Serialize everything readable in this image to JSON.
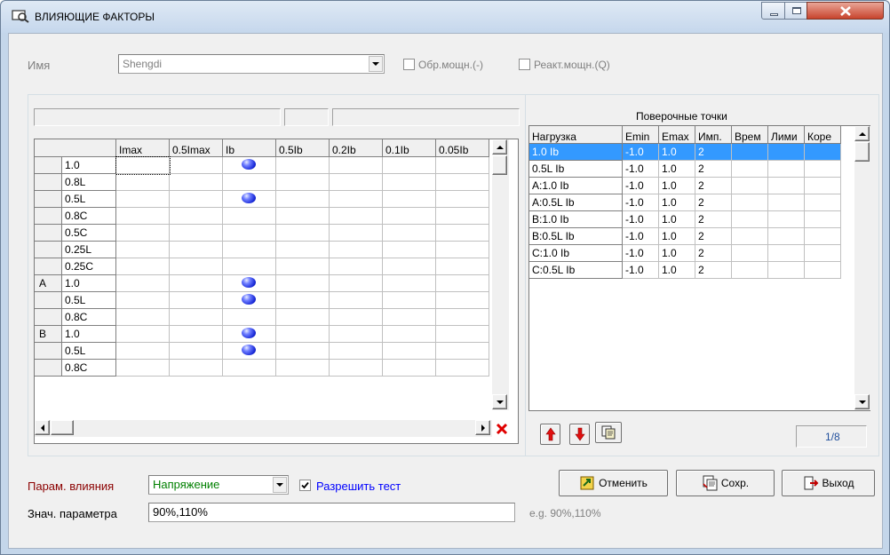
{
  "window": {
    "title": "ВЛИЯЮЩИЕ ФАКТОРЫ"
  },
  "top": {
    "name_label": "Имя",
    "name_value": "Shengdi",
    "check_active_power": "Обр.мощн.(-)",
    "check_reactive_power": "Реакт.мощн.(Q)"
  },
  "matrix": {
    "columns": [
      "Imax",
      "0.5Imax",
      "Ib",
      "0.5Ib",
      "0.2Ib",
      "0.1Ib",
      "0.05Ib"
    ],
    "rows": [
      {
        "group": "",
        "pf": "1.0",
        "marks": [
          false,
          false,
          true,
          false,
          false,
          false,
          false
        ]
      },
      {
        "group": "",
        "pf": "0.8L",
        "marks": [
          false,
          false,
          false,
          false,
          false,
          false,
          false
        ]
      },
      {
        "group": "",
        "pf": "0.5L",
        "marks": [
          false,
          false,
          true,
          false,
          false,
          false,
          false
        ]
      },
      {
        "group": "",
        "pf": "0.8C",
        "marks": [
          false,
          false,
          false,
          false,
          false,
          false,
          false
        ]
      },
      {
        "group": "",
        "pf": "0.5C",
        "marks": [
          false,
          false,
          false,
          false,
          false,
          false,
          false
        ]
      },
      {
        "group": "",
        "pf": "0.25L",
        "marks": [
          false,
          false,
          false,
          false,
          false,
          false,
          false
        ]
      },
      {
        "group": "",
        "pf": "0.25C",
        "marks": [
          false,
          false,
          false,
          false,
          false,
          false,
          false
        ]
      },
      {
        "group": "A",
        "pf": "1.0",
        "marks": [
          false,
          false,
          true,
          false,
          false,
          false,
          false
        ]
      },
      {
        "group": "",
        "pf": "0.5L",
        "marks": [
          false,
          false,
          true,
          false,
          false,
          false,
          false
        ]
      },
      {
        "group": "",
        "pf": "0.8C",
        "marks": [
          false,
          false,
          false,
          false,
          false,
          false,
          false
        ]
      },
      {
        "group": "B",
        "pf": "1.0",
        "marks": [
          false,
          false,
          true,
          false,
          false,
          false,
          false
        ]
      },
      {
        "group": "",
        "pf": "0.5L",
        "marks": [
          false,
          false,
          true,
          false,
          false,
          false,
          false
        ]
      },
      {
        "group": "",
        "pf": "0.8C",
        "marks": [
          false,
          false,
          false,
          false,
          false,
          false,
          false
        ]
      }
    ]
  },
  "points": {
    "title": "Поверочные точки",
    "columns": [
      "Нагрузка",
      "Emin",
      "Emax",
      "Имп.",
      "Врем",
      "Лими",
      "Коре"
    ],
    "rows": [
      [
        "1.0 Ib",
        "-1.0",
        "1.0",
        "2",
        "",
        "",
        ""
      ],
      [
        "0.5L Ib",
        "-1.0",
        "1.0",
        "2",
        "",
        "",
        ""
      ],
      [
        "A:1.0 Ib",
        "-1.0",
        "1.0",
        "2",
        "",
        "",
        ""
      ],
      [
        "A:0.5L Ib",
        "-1.0",
        "1.0",
        "2",
        "",
        "",
        ""
      ],
      [
        "B:1.0 Ib",
        "-1.0",
        "1.0",
        "2",
        "",
        "",
        ""
      ],
      [
        "B:0.5L Ib",
        "-1.0",
        "1.0",
        "2",
        "",
        "",
        ""
      ],
      [
        "C:1.0 Ib",
        "-1.0",
        "1.0",
        "2",
        "",
        "",
        ""
      ],
      [
        "C:0.5L Ib",
        "-1.0",
        "1.0",
        "2",
        "",
        "",
        ""
      ]
    ],
    "selected_row": 0,
    "page": "1/8"
  },
  "bottom": {
    "param_label": "Парам. влияния",
    "param_value": "Напряжение",
    "enable_test_label": "Разрешить тест",
    "enable_test_checked": true,
    "value_label": "Знач. параметра",
    "value_input": "90%,110%",
    "example_hint": "e.g. 90%,110%"
  },
  "buttons": {
    "cancel": "Отменить",
    "save": "Сохр.",
    "exit": "Выход"
  },
  "colors": {
    "selection": "#3399ff",
    "param_label": "#8b0000",
    "param_value": "#008000",
    "enable_test": "#0000ff",
    "page_counter": "#1f4e9c"
  }
}
